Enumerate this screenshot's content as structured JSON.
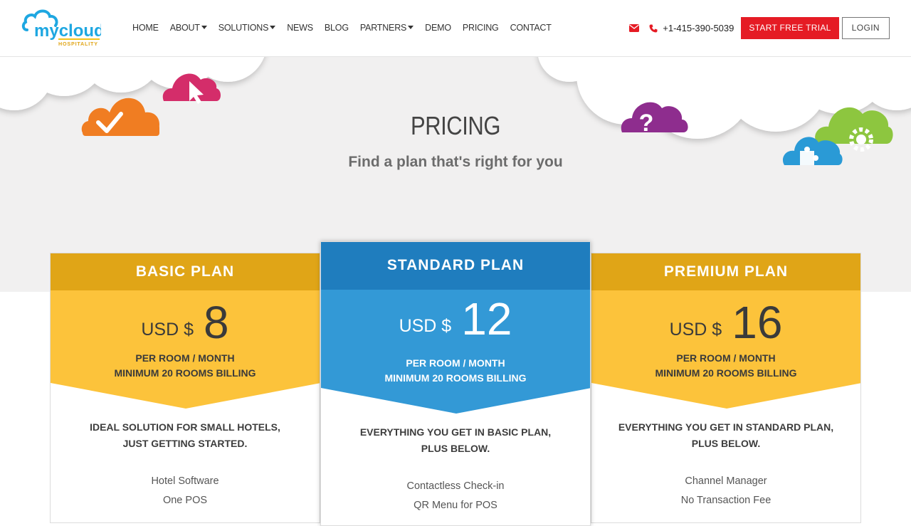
{
  "header": {
    "logo_text": "mycloud",
    "logo_sub": "HOSPITALITY",
    "nav": [
      {
        "label": "HOME",
        "dropdown": false
      },
      {
        "label": "ABOUT",
        "dropdown": true
      },
      {
        "label": "SOLUTIONS",
        "dropdown": true
      },
      {
        "label": "NEWS",
        "dropdown": false
      },
      {
        "label": "BLOG",
        "dropdown": false
      },
      {
        "label": "PARTNERS",
        "dropdown": true
      },
      {
        "label": "DEMO",
        "dropdown": false
      },
      {
        "label": "PRICING",
        "dropdown": false
      },
      {
        "label": "CONTACT",
        "dropdown": false
      }
    ],
    "phone": "+1-415-390-5039",
    "trial_label": "START FREE TRIAL",
    "login_label": "LOGIN"
  },
  "hero": {
    "title": "PRICING",
    "subtitle": "Find a plan that's right for you"
  },
  "plans": {
    "basic": {
      "name": "BASIC PLAN",
      "currency": "USD $",
      "amount": "8",
      "per": "PER ROOM / MONTH",
      "min": "MINIMUM 20 ROOMS BILLING",
      "desc1": "IDEAL SOLUTION FOR SMALL HOTELS,",
      "desc2": "JUST GETTING STARTED.",
      "features": [
        "Hotel Software",
        "One POS"
      ]
    },
    "standard": {
      "name": "STANDARD PLAN",
      "currency": "USD $",
      "amount": "12",
      "per": "PER ROOM / MONTH",
      "min": "MINIMUM 20 ROOMS BILLING",
      "desc1": "EVERYTHING YOU GET IN BASIC PLAN,",
      "desc2": "PLUS BELOW.",
      "features": [
        "Contactless Check-in",
        "QR Menu for POS"
      ]
    },
    "premium": {
      "name": "PREMIUM PLAN",
      "currency": "USD $",
      "amount": "16",
      "per": "PER ROOM / MONTH",
      "min": "MINIMUM 20 ROOMS BILLING",
      "desc1": "EVERYTHING YOU GET IN STANDARD PLAN,",
      "desc2": "PLUS BELOW.",
      "features": [
        "Channel Manager",
        "No Transaction Fee"
      ]
    }
  },
  "colors": {
    "brand_blue": "#1ea7e1",
    "gold_header": "#e0a517",
    "gold_band": "#fcc33b",
    "blue_header": "#1f7dbe",
    "blue_band": "#3399d6",
    "trial_red": "#e51b24"
  },
  "icons": [
    "cloud-logo-icon",
    "envelope-icon",
    "phone-icon",
    "check-cloud-icon",
    "cursor-cloud-icon",
    "question-cloud-icon",
    "puzzle-cloud-icon",
    "gear-cloud-icon"
  ]
}
